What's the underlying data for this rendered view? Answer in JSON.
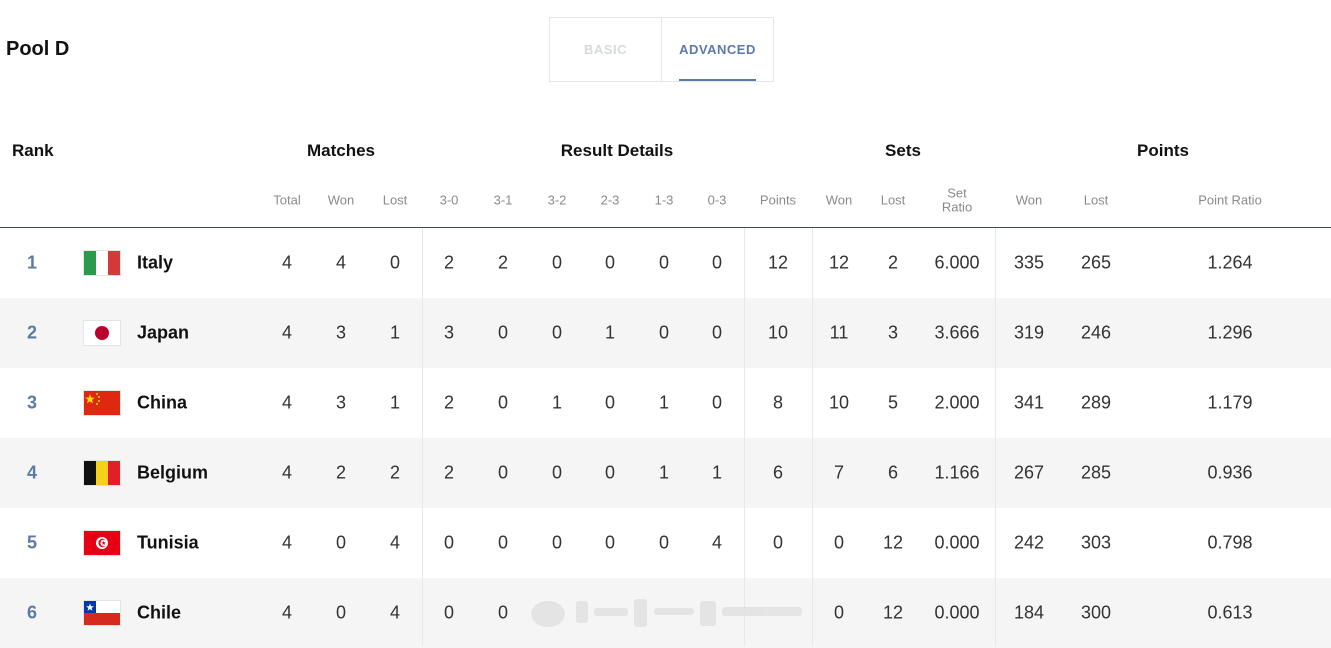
{
  "pool_title": "Pool D",
  "tabs": [
    {
      "label": "BASIC",
      "active": false
    },
    {
      "label": "ADVANCED",
      "active": true
    }
  ],
  "groups": {
    "rank": "Rank",
    "matches": "Matches",
    "result_details": "Result Details",
    "sets": "Sets",
    "points": "Points"
  },
  "subheaders": {
    "total": "Total",
    "won": "Won",
    "lost": "Lost",
    "r30": "3-0",
    "r31": "3-1",
    "r32": "3-2",
    "r23": "2-3",
    "r13": "1-3",
    "r03": "0-3",
    "points": "Points",
    "sets_won": "Won",
    "sets_lost": "Lost",
    "set_ratio_1": "Set",
    "set_ratio_2": "Ratio",
    "pts_won": "Won",
    "pts_lost": "Lost",
    "point_ratio": "Point Ratio"
  },
  "colors": {
    "accent": "#5b7aa8",
    "row_alt": "#f5f5f5",
    "header_line": "#3f4b57"
  },
  "rows": [
    {
      "rank": "1",
      "flag": "italy-flag-icon",
      "team": "Italy",
      "total": "4",
      "won": "4",
      "lost": "0",
      "r30": "2",
      "r31": "2",
      "r32": "0",
      "r23": "0",
      "r13": "0",
      "r03": "0",
      "points": "12",
      "sets_won": "12",
      "sets_lost": "2",
      "set_ratio": "6.000",
      "pts_won": "335",
      "pts_lost": "265",
      "point_ratio": "1.264"
    },
    {
      "rank": "2",
      "flag": "japan-flag-icon",
      "team": "Japan",
      "total": "4",
      "won": "3",
      "lost": "1",
      "r30": "3",
      "r31": "0",
      "r32": "0",
      "r23": "1",
      "r13": "0",
      "r03": "0",
      "points": "10",
      "sets_won": "11",
      "sets_lost": "3",
      "set_ratio": "3.666",
      "pts_won": "319",
      "pts_lost": "246",
      "point_ratio": "1.296"
    },
    {
      "rank": "3",
      "flag": "china-flag-icon",
      "team": "China",
      "total": "4",
      "won": "3",
      "lost": "1",
      "r30": "2",
      "r31": "0",
      "r32": "1",
      "r23": "0",
      "r13": "1",
      "r03": "0",
      "points": "8",
      "sets_won": "10",
      "sets_lost": "5",
      "set_ratio": "2.000",
      "pts_won": "341",
      "pts_lost": "289",
      "point_ratio": "1.179"
    },
    {
      "rank": "4",
      "flag": "belgium-flag-icon",
      "team": "Belgium",
      "total": "4",
      "won": "2",
      "lost": "2",
      "r30": "2",
      "r31": "0",
      "r32": "0",
      "r23": "0",
      "r13": "1",
      "r03": "1",
      "points": "6",
      "sets_won": "7",
      "sets_lost": "6",
      "set_ratio": "1.166",
      "pts_won": "267",
      "pts_lost": "285",
      "point_ratio": "0.936"
    },
    {
      "rank": "5",
      "flag": "tunisia-flag-icon",
      "team": "Tunisia",
      "total": "4",
      "won": "0",
      "lost": "4",
      "r30": "0",
      "r31": "0",
      "r32": "0",
      "r23": "0",
      "r13": "0",
      "r03": "4",
      "points": "0",
      "sets_won": "0",
      "sets_lost": "12",
      "set_ratio": "0.000",
      "pts_won": "242",
      "pts_lost": "303",
      "point_ratio": "0.798"
    },
    {
      "rank": "6",
      "flag": "chile-flag-icon",
      "team": "Chile",
      "total": "4",
      "won": "0",
      "lost": "4",
      "r30": "0",
      "r31": "0",
      "r32": "",
      "r23": "",
      "r13": "",
      "r03": "",
      "points": "",
      "sets_won": "0",
      "sets_lost": "12",
      "set_ratio": "0.000",
      "pts_won": "184",
      "pts_lost": "300",
      "point_ratio": "0.613"
    }
  ]
}
